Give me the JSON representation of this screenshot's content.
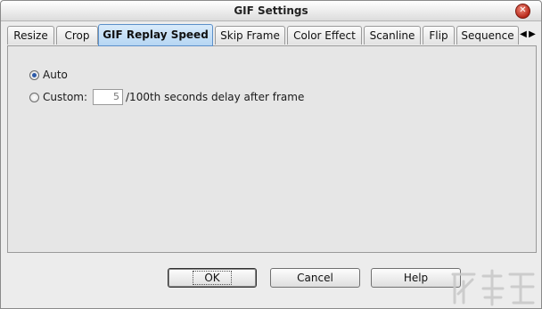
{
  "window": {
    "title": "GIF Settings",
    "close_icon": "close-icon"
  },
  "tabs": [
    {
      "label": "Resize"
    },
    {
      "label": "Crop"
    },
    {
      "label": "GIF Replay Speed"
    },
    {
      "label": "Skip Frame"
    },
    {
      "label": "Color Effect"
    },
    {
      "label": "Scanline"
    },
    {
      "label": "Flip"
    },
    {
      "label": "Sequence"
    }
  ],
  "active_tab": "GIF Replay Speed",
  "replay": {
    "auto_label": "Auto",
    "custom_label": "Custom:",
    "custom_value": "5",
    "delay_suffix": "/100th seconds delay after frame",
    "selected": "Auto"
  },
  "buttons": {
    "ok": "OK",
    "cancel": "Cancel",
    "help": "Help"
  },
  "colors": {
    "active_tab": "#b6d6f3",
    "radio_dot": "#2d5aa8"
  }
}
